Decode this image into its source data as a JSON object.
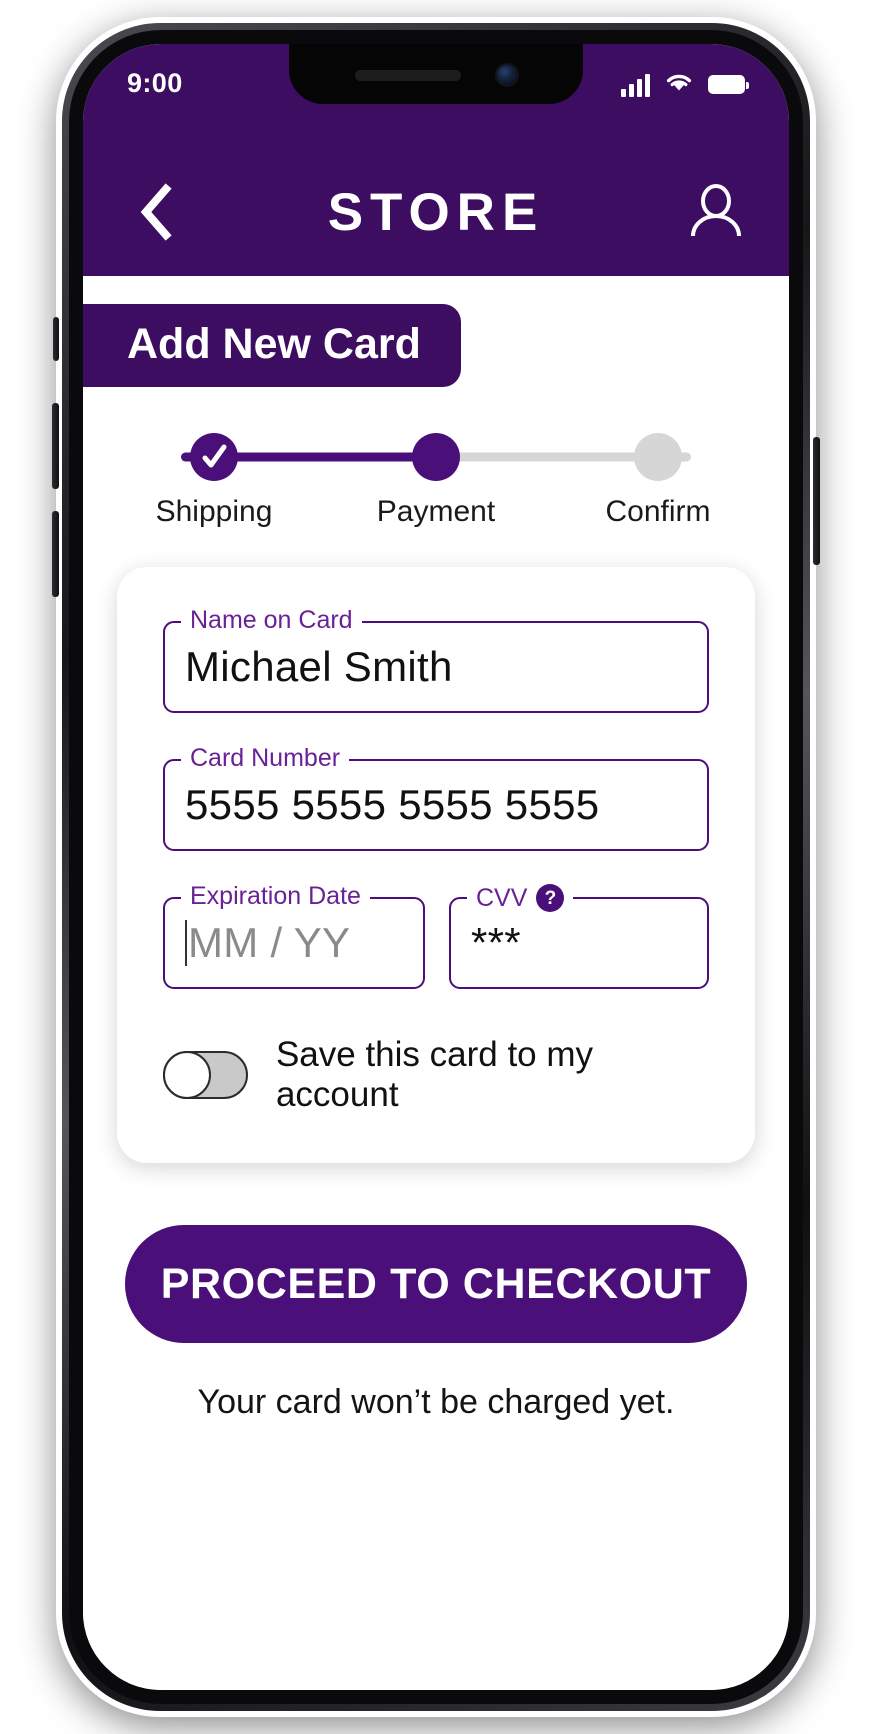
{
  "status_bar": {
    "time": "9:00",
    "signal_icon": "cellular-signal-icon",
    "wifi_icon": "wifi-icon",
    "battery_icon": "battery-icon"
  },
  "header": {
    "back_icon": "chevron-left-icon",
    "title": "STORE",
    "account_icon": "person-icon",
    "background_color": "#3C0D60"
  },
  "page": {
    "banner_title": "Add New Card"
  },
  "stepper": {
    "steps": [
      {
        "label": "Shipping",
        "state": "done",
        "icon": "check-icon"
      },
      {
        "label": "Payment",
        "state": "current",
        "icon": ""
      },
      {
        "label": "Confirm",
        "state": "todo",
        "icon": ""
      }
    ],
    "active_color": "#4A0F78",
    "inactive_color": "#D6D6D6"
  },
  "form": {
    "name_on_card": {
      "label": "Name on Card",
      "value": "Michael Smith",
      "placeholder": "Name on Card"
    },
    "card_number": {
      "label": "Card Number",
      "value": "5555  5555  5555  5555",
      "placeholder": "Card Number"
    },
    "expiration": {
      "label": "Expiration Date",
      "value": "",
      "placeholder": "MM / YY"
    },
    "cvv": {
      "label": "CVV",
      "value": "***",
      "placeholder": "CVV",
      "help_icon": "question-mark-icon"
    },
    "save_card": {
      "label": "Save this card to my account",
      "state": "off"
    }
  },
  "actions": {
    "checkout_label": "PROCEED TO CHECKOUT",
    "footnote": "Your card won’t be charged yet."
  }
}
